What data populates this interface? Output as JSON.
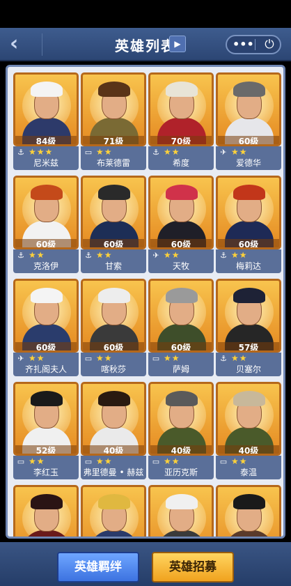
{
  "header": {
    "title": "英雄列表",
    "back_icon": "‹",
    "sort_icon": "▶",
    "more_icon": "•••",
    "power_icon": "⏻"
  },
  "heroes": [
    {
      "name": "尼米兹",
      "level": "84级",
      "stars": "★★★",
      "class_icon": "⚓",
      "hair": "#f4f4f4",
      "body": "#2d3a6a"
    },
    {
      "name": "布莱德雷",
      "level": "71级",
      "stars": "★★",
      "class_icon": "▭",
      "hair": "#5a3418",
      "body": "#7a6a34"
    },
    {
      "name": "希度",
      "level": "70级",
      "stars": "★★",
      "class_icon": "⚓",
      "hair": "#e8e4d6",
      "body": "#b0222a"
    },
    {
      "name": "爱德华",
      "level": "60级",
      "stars": "★★",
      "class_icon": "✈",
      "hair": "#6a6a6a",
      "body": "#e6e6ea"
    },
    {
      "name": "克洛伊",
      "level": "60级",
      "stars": "★★",
      "class_icon": "⚓",
      "hair": "#c44a1a",
      "body": "#f2f2f2"
    },
    {
      "name": "甘索",
      "level": "60级",
      "stars": "★★",
      "class_icon": "⚓",
      "hair": "#2a2a2a",
      "body": "#1d2e56"
    },
    {
      "name": "天牧",
      "level": "60级",
      "stars": "★★",
      "class_icon": "✈",
      "hair": "#d0324a",
      "body": "#1f1f28"
    },
    {
      "name": "梅莉达",
      "level": "60级",
      "stars": "★★",
      "class_icon": "⚓",
      "hair": "#c2361a",
      "body": "#1e2a56"
    },
    {
      "name": "齐扎阁夫人",
      "level": "60级",
      "stars": "★★",
      "class_icon": "✈",
      "hair": "#f4f4f4",
      "body": "#2a3c6c"
    },
    {
      "name": "喀秋莎",
      "level": "60级",
      "stars": "★★",
      "class_icon": "▭",
      "hair": "#ededed",
      "body": "#3a3a3a"
    },
    {
      "name": "萨姆",
      "level": "60级",
      "stars": "★★",
      "class_icon": "▭",
      "hair": "#9a9a9a",
      "body": "#3e4e2a"
    },
    {
      "name": "贝塞尔",
      "level": "57级",
      "stars": "★★",
      "class_icon": "⚓",
      "hair": "#1e2236",
      "body": "#262626"
    },
    {
      "name": "李红玉",
      "level": "52级",
      "stars": "★★",
      "class_icon": "▭",
      "hair": "#1a1a1a",
      "body": "#f0f0f0"
    },
    {
      "name": "弗里德曼 • 赫兹",
      "level": "40级",
      "stars": "★★",
      "class_icon": "▭",
      "hair": "#2a1a10",
      "body": "#eaeaea"
    },
    {
      "name": "亚历克斯",
      "level": "40级",
      "stars": "★★",
      "class_icon": "▭",
      "hair": "#5a5a5a",
      "body": "#4a5a2a"
    },
    {
      "name": "泰温",
      "level": "40级",
      "stars": "★★",
      "class_icon": "▭",
      "hair": "#c8b89a",
      "body": "#4a5a2a"
    },
    {
      "name": "",
      "level": "",
      "stars": "",
      "class_icon": "",
      "hair": "#2a1414",
      "body": "#6a1a1a"
    },
    {
      "name": "",
      "level": "",
      "stars": "",
      "class_icon": "",
      "hair": "#e0b840",
      "body": "#2a3a6a"
    },
    {
      "name": "",
      "level": "",
      "stars": "",
      "class_icon": "",
      "hair": "#f0f0f0",
      "body": "#3a3a3a"
    },
    {
      "name": "",
      "level": "",
      "stars": "",
      "class_icon": "",
      "hair": "#1a1a1a",
      "body": "#5a3a2a"
    }
  ],
  "footer": {
    "bonds_label": "英雄羁绊",
    "recruit_label": "英雄招募"
  }
}
